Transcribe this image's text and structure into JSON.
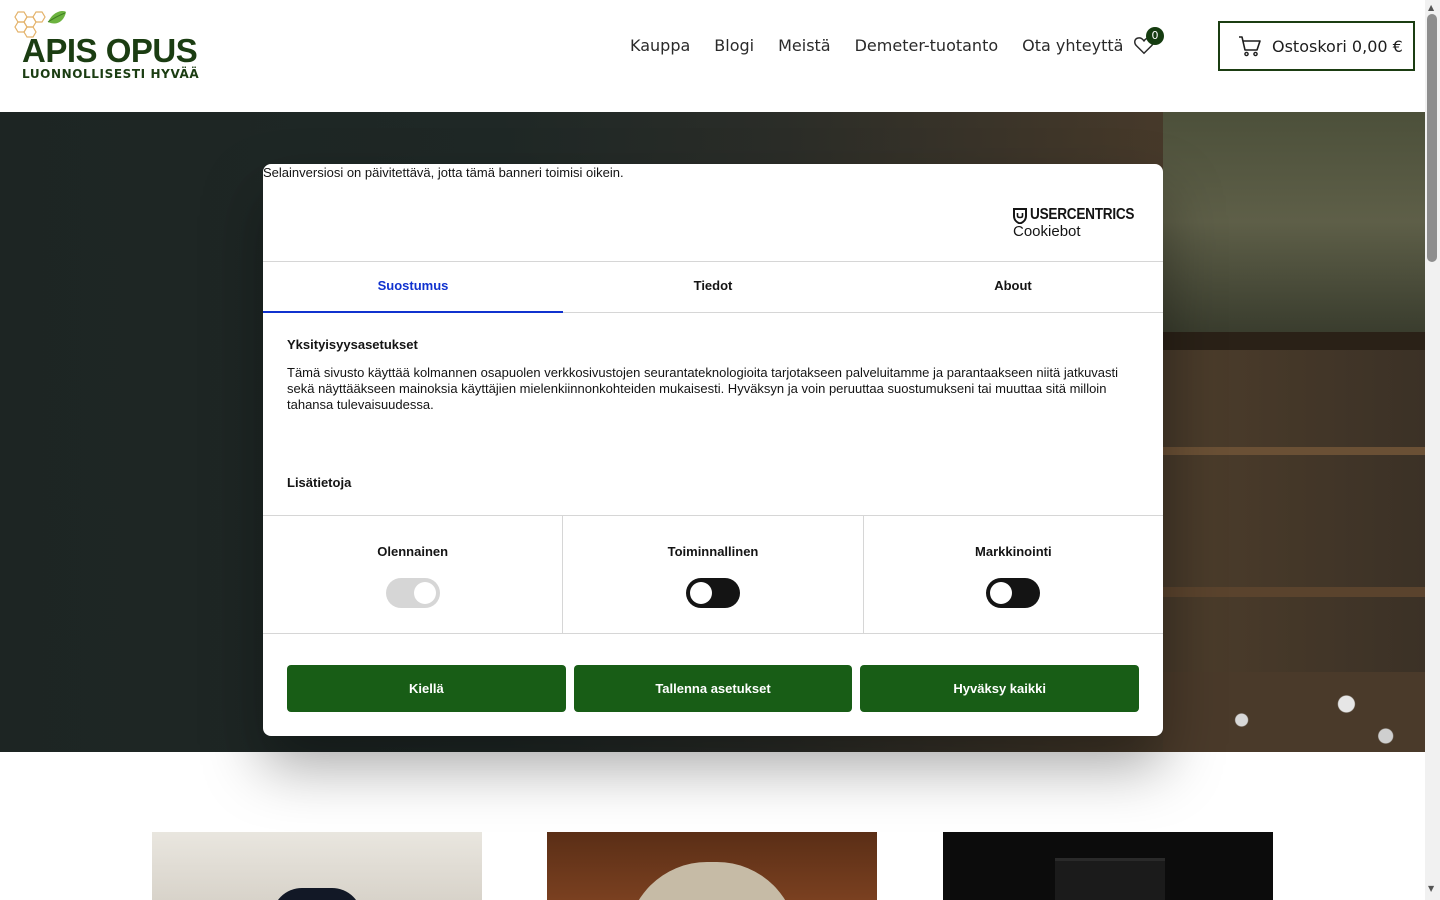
{
  "header": {
    "logo_title": "APIS OPUS",
    "logo_subtitle": "LUONNOLLISESTI HYVÄÄ",
    "nav": [
      "Kauppa",
      "Blogi",
      "Meistä",
      "Demeter-tuotanto",
      "Ota yhteyttä"
    ],
    "wishlist_count": "0",
    "cart_label": "Ostoskori 0,00 €"
  },
  "consent": {
    "browser_warning": "Selainversiosi on päivitettävä, jotta tämä banneri toimisi oikein.",
    "brand_name": "USERCENTRICS",
    "brand_sub": "Cookiebot",
    "tabs": [
      "Suostumus",
      "Tiedot",
      "About"
    ],
    "active_tab": "Suostumus",
    "section_title": "Yksityisyysasetukset",
    "section_body": "Tämä sivusto käyttää kolmannen osapuolen verkkosivustojen seurantateknologioita tarjotakseen palveluitamme ja parantaakseen niitä jatkuvasti sekä näyttääkseen mainoksia käyttäjien mielenkiinnonkohteiden mukaisesti. Hyväksyn ja voin peruuttaa suostumukseni tai muuttaa sitä milloin tahansa tulevaisuudessa.",
    "more_label": "Lisätietoja",
    "toggles": [
      {
        "label": "Olennainen",
        "state": "on-disabled"
      },
      {
        "label": "Toiminnallinen",
        "state": "off"
      },
      {
        "label": "Markkinointi",
        "state": "off"
      }
    ],
    "buttons": {
      "deny": "Kiellä",
      "save": "Tallenna asetukset",
      "accept": "Hyväksy kaikki"
    },
    "button_color": "#185d16",
    "active_tab_color": "#1032cf"
  },
  "colors": {
    "brand_green": "#1b3d12"
  }
}
